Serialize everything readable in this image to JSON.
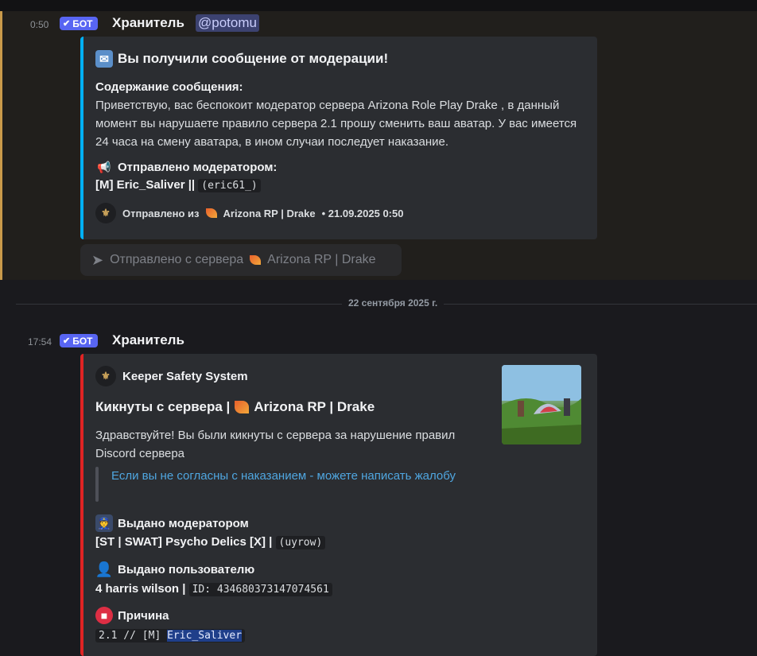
{
  "message1": {
    "time": "0:50",
    "badge": "БОТ",
    "author": "Хранитель",
    "mention": "@potomu",
    "embed": {
      "title": "Вы получили сообщение от модерации!",
      "content_label": "Содержание сообщения:",
      "content_text": "Приветствую, вас беспокоит модератор сервера Arizona Role Play Drake , в данный момент вы нарушаете правило сервера 2.1 прошу сменить ваш аватар. У вас имеется 24 часа на смену аватара, в ином случаи последует наказание.",
      "sent_by_label": "Отправлено модератором:",
      "moderator_name": "[M] Eric_Saliver ||",
      "moderator_tag": "(eric61_)",
      "footer_prefix": "Отправлено из",
      "footer_server": "Arizona RP | Drake",
      "footer_time": "• 21.09.2025 0:50",
      "accent_color": "#00b0f4"
    },
    "forwarded_label": "Отправлено с сервера",
    "forwarded_server": "Arizona RP | Drake"
  },
  "divider": {
    "label": "22 сентября 2025 г."
  },
  "message2": {
    "time": "17:54",
    "badge": "БОТ",
    "author": "Хранитель",
    "embed": {
      "author_name": "Keeper Safety System",
      "title_prefix": "Кикнуты с сервера |",
      "title_server": "Arizona RP | Drake",
      "description": "Здравствуйте! Вы были кикнуты с сервера за нарушение правил Discord сервера",
      "quote": "Если вы не согласны с наказанием - можете написать жалобу",
      "field_moderator_label": "Выдано модератором",
      "field_moderator_value": "[ST | SWAT] Psycho Delics [X] |",
      "field_moderator_tag": "(uyrow)",
      "field_user_label": "Выдано пользователю",
      "field_user_value": "4 harris wilson |",
      "field_user_id": "ID: 434680373147074561",
      "field_reason_label": "Причина",
      "field_reason_code": "2.1 // [M]",
      "field_reason_selected": "Eric_Saliver",
      "accent_color": "#e02424"
    }
  },
  "icons": [
    "envelope-icon",
    "megaphone-icon",
    "send-arrow-icon",
    "police-officer-icon",
    "user-silhouette-icon",
    "stop-sign-icon",
    "checkmark-icon"
  ]
}
